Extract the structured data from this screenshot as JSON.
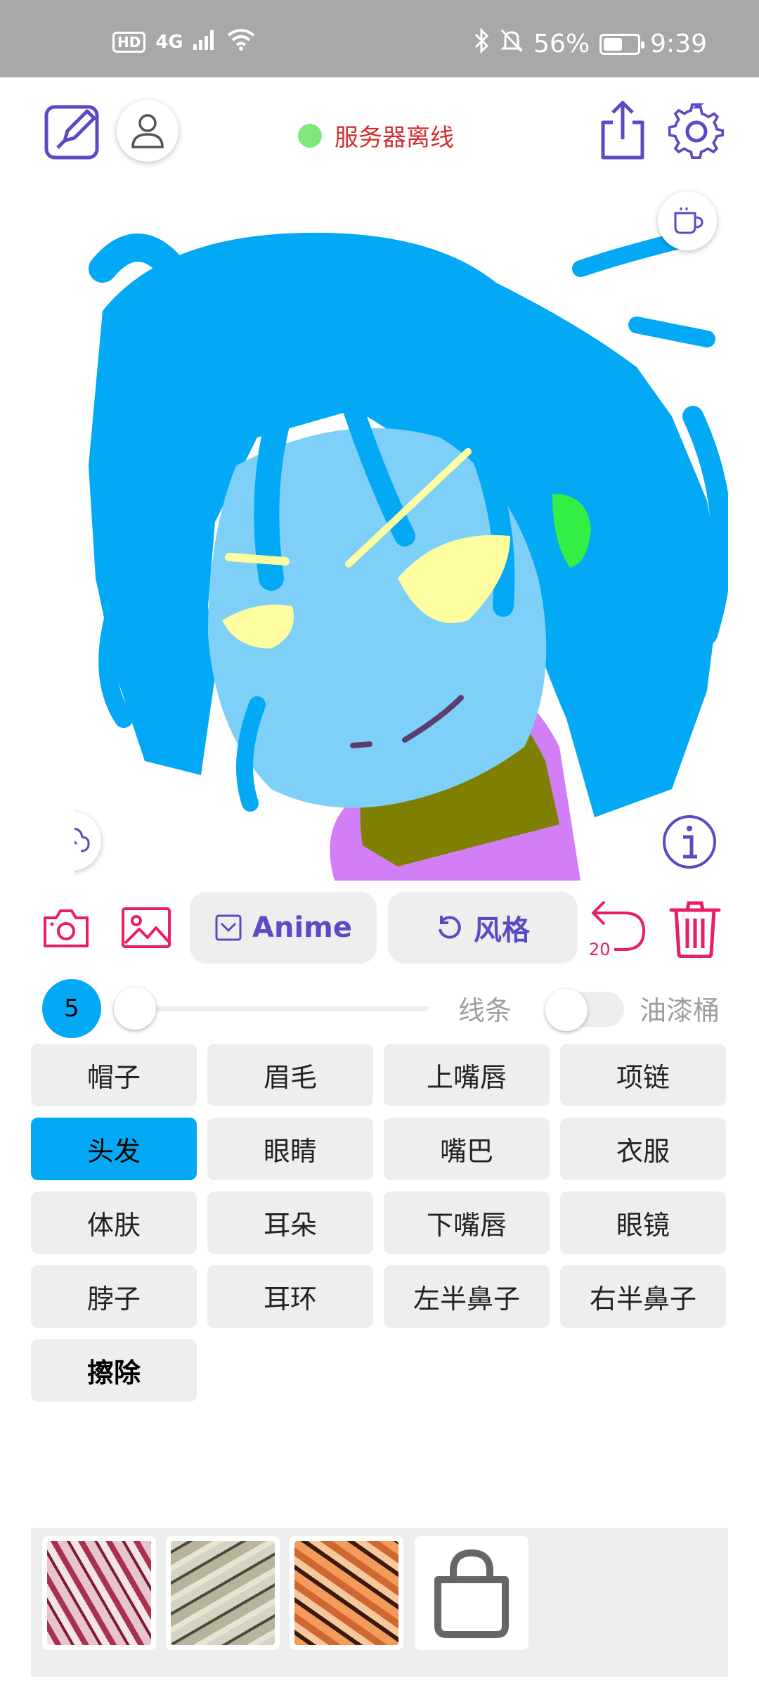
{
  "status_bar": {
    "hd": "HD",
    "network": "4G",
    "battery": "56%",
    "battery_level": 0.56,
    "time": "9:39"
  },
  "header": {
    "server_status": "服务器离线",
    "server_dot_color": "#7ee87e",
    "accent_color": "#5a4bc4"
  },
  "toolbar": {
    "model_label": "Anime",
    "style_label": "风格",
    "undo_count": "20"
  },
  "brush": {
    "size": "5",
    "size_level": 0.0,
    "line_label": "线条",
    "bucket_label": "油漆桶",
    "bucket_on": false
  },
  "parts": [
    {
      "label": "帽子",
      "active": false
    },
    {
      "label": "眉毛",
      "active": false
    },
    {
      "label": "上嘴唇",
      "active": false
    },
    {
      "label": "项链",
      "active": false
    },
    {
      "label": "头发",
      "active": true
    },
    {
      "label": "眼睛",
      "active": false
    },
    {
      "label": "嘴巴",
      "active": false
    },
    {
      "label": "衣服",
      "active": false
    },
    {
      "label": "体肤",
      "active": false
    },
    {
      "label": "耳朵",
      "active": false
    },
    {
      "label": "下嘴唇",
      "active": false
    },
    {
      "label": "眼镜",
      "active": false
    },
    {
      "label": "脖子",
      "active": false
    },
    {
      "label": "耳环",
      "active": false
    },
    {
      "label": "左半鼻子",
      "active": false
    },
    {
      "label": "右半鼻子",
      "active": false
    },
    {
      "label": "擦除",
      "active": false,
      "bold": true
    }
  ],
  "colors": {
    "hair": "#03a9f4",
    "skin": "#7fd0f8",
    "eyes": "#fefea0",
    "ear": "#33ee44",
    "neck": "#808000",
    "clothes": "#d17ef7",
    "mouth": "#5d3d6e",
    "active_chip": "#03a9f4",
    "icon_red": "#e91e63"
  },
  "textures": [
    "crimson-marble",
    "gray-marble",
    "orange-marble",
    "locked-bag"
  ]
}
